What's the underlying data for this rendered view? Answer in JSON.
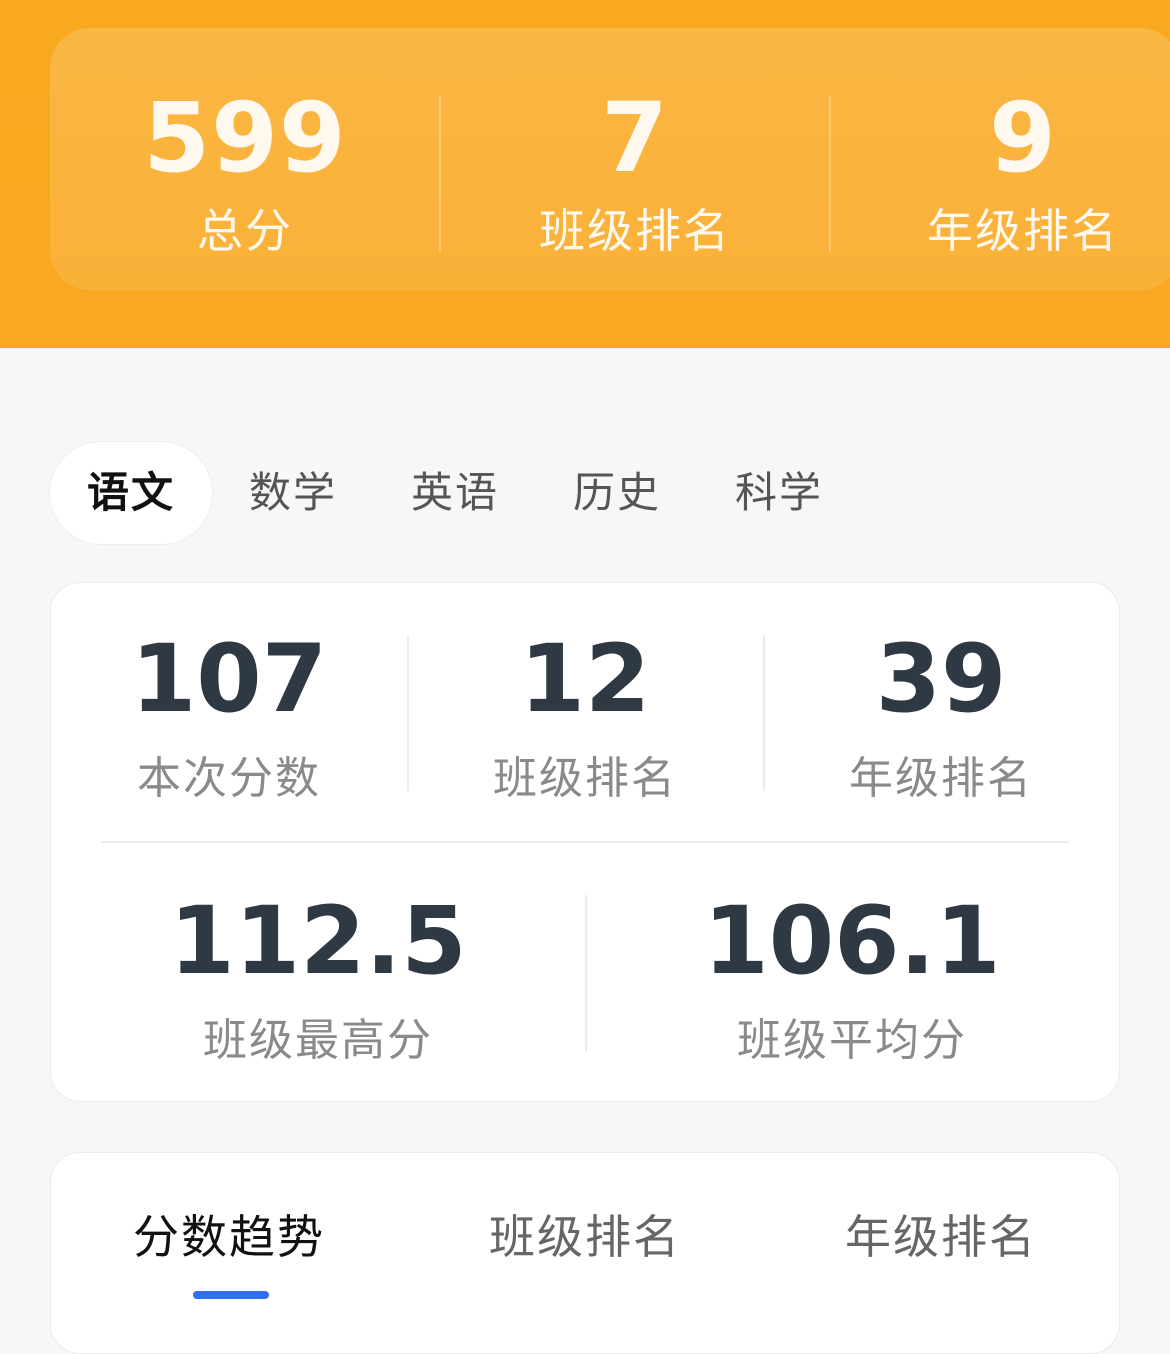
{
  "summary": {
    "total_score": "599",
    "total_score_label": "总分",
    "class_rank": "7",
    "class_rank_label": "班级排名",
    "grade_rank": "9",
    "grade_rank_label": "年级排名"
  },
  "subjects": {
    "tabs": [
      "语文",
      "数学",
      "英语",
      "历史",
      "科学"
    ],
    "active": "语文"
  },
  "subject_stats": {
    "score": "107",
    "score_label": "本次分数",
    "class_rank": "12",
    "class_rank_label": "班级排名",
    "grade_rank": "39",
    "grade_rank_label": "年级排名",
    "class_max": "112.5",
    "class_max_label": "班级最高分",
    "class_avg": "106.1",
    "class_avg_label": "班级平均分"
  },
  "trend": {
    "tabs": [
      "分数趋势",
      "班级排名",
      "年级排名"
    ],
    "active": "分数趋势"
  },
  "colors": {
    "header_orange": "#f8a91f",
    "accent_blue": "#2f6ff0",
    "stat_number": "#2e3944"
  }
}
